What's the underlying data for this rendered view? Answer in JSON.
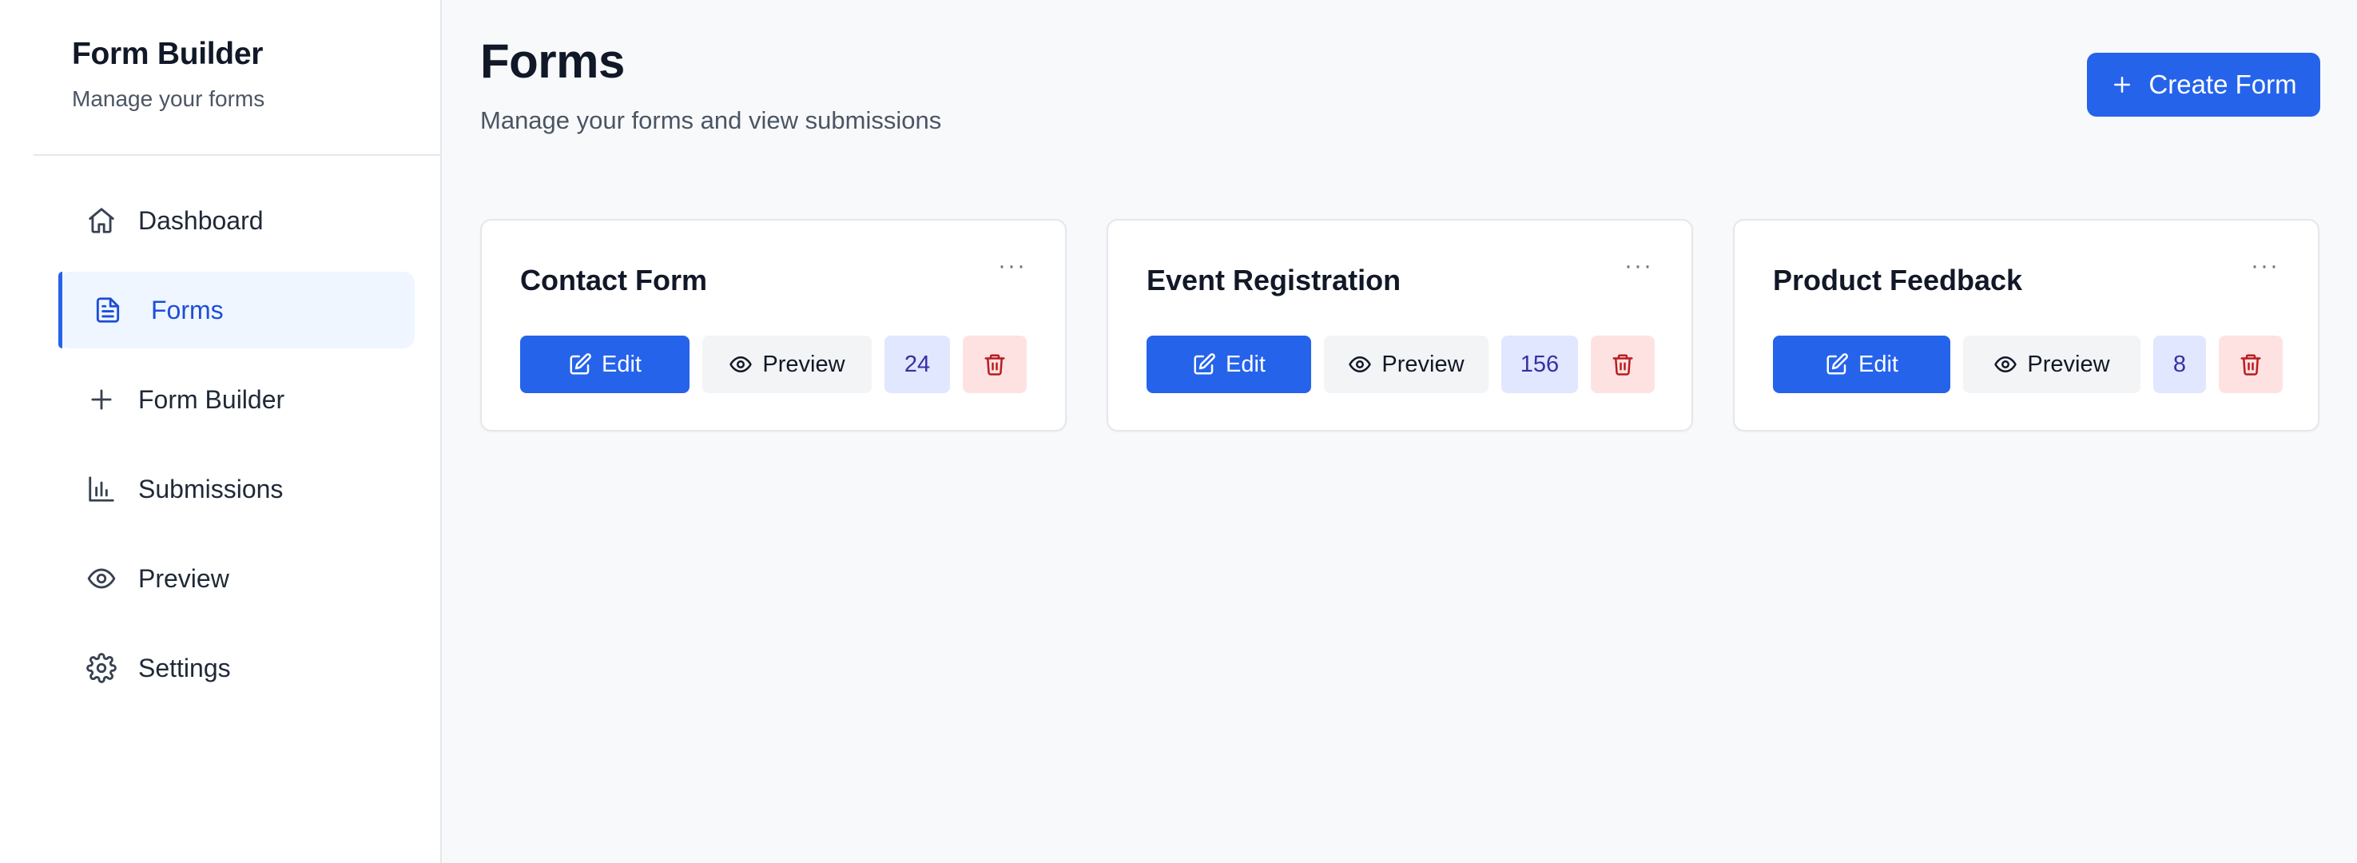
{
  "sidebar": {
    "title": "Form Builder",
    "subtitle": "Manage your forms",
    "items": [
      {
        "label": "Dashboard",
        "icon": "home-icon"
      },
      {
        "label": "Forms",
        "icon": "file-text-icon",
        "active": true
      },
      {
        "label": "Form Builder",
        "icon": "plus-icon"
      },
      {
        "label": "Submissions",
        "icon": "bar-chart-icon"
      },
      {
        "label": "Preview",
        "icon": "eye-icon"
      },
      {
        "label": "Settings",
        "icon": "gear-icon"
      }
    ]
  },
  "header": {
    "title": "Forms",
    "subtitle": "Manage your forms and view submissions",
    "create_label": "Create Form"
  },
  "cards": [
    {
      "title": "Contact Form",
      "menu": "···",
      "edit_label": "Edit",
      "preview_label": "Preview",
      "count": "24"
    },
    {
      "title": "Event Registration",
      "menu": "···",
      "edit_label": "Edit",
      "preview_label": "Preview",
      "count": "156"
    },
    {
      "title": "Product Feedback",
      "menu": "···",
      "edit_label": "Edit",
      "preview_label": "Preview",
      "count": "8"
    }
  ],
  "colors": {
    "accent": "#2563eb",
    "active_bg": "#eff6ff",
    "count_bg": "#e0e7ff",
    "delete_bg": "#fee2e2",
    "delete_fg": "#b91c1c"
  }
}
